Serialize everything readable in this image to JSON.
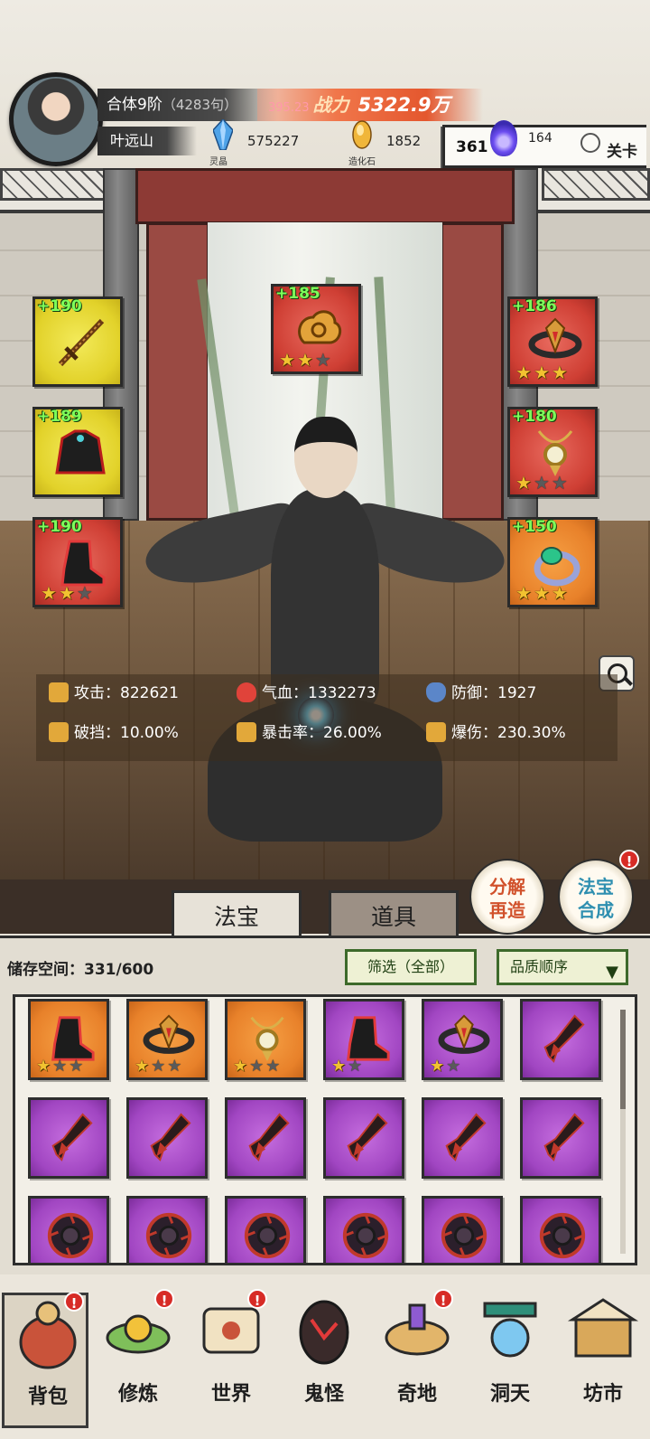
{
  "player": {
    "realm": "合体9阶",
    "realm_sub": "（4283句）",
    "name": "叶远山",
    "power_ghost": "395.23",
    "power_label": "战力",
    "power_value": "5322.9万"
  },
  "resources": [
    {
      "name": "灵晶",
      "value": "575227",
      "icon": "blue-crystal-icon",
      "color": "#4fa3e8"
    },
    {
      "name": "造化石",
      "value": "1852",
      "icon": "golden-stone-icon",
      "color": "#f0b63a"
    }
  ],
  "stage": {
    "left": "361",
    "count": "164",
    "right": "关卡",
    "icon": "purple-flame-icon"
  },
  "equipped": {
    "left": [
      {
        "bonus": "+190",
        "quality": "yellow",
        "icon": "sword-icon",
        "stars": null
      },
      {
        "bonus": "+189",
        "quality": "yellow",
        "icon": "robe-armor-icon",
        "stars": null
      },
      {
        "bonus": "+190",
        "quality": "red",
        "icon": "boots-icon",
        "stars": [
          1,
          1,
          0
        ]
      }
    ],
    "top": {
      "bonus": "+185",
      "quality": "red",
      "icon": "golden-cloud-charm-icon",
      "stars": [
        1,
        1,
        0
      ]
    },
    "right": [
      {
        "bonus": "+186",
        "quality": "red",
        "icon": "crown-belt-icon",
        "stars": [
          1,
          1,
          1
        ]
      },
      {
        "bonus": "+180",
        "quality": "red",
        "icon": "pendant-icon",
        "stars": [
          1,
          0,
          0
        ]
      },
      {
        "bonus": "+150",
        "quality": "orange",
        "icon": "jade-ring-icon",
        "stars": [
          1,
          1,
          1
        ]
      }
    ]
  },
  "stats": [
    {
      "label": "攻击",
      "value": "822621",
      "icon": "sword-stat-icon",
      "color": "#e2a83a"
    },
    {
      "label": "气血",
      "value": "1332273",
      "icon": "heart-icon",
      "color": "#e0433a"
    },
    {
      "label": "防御",
      "value": "1927",
      "icon": "shield-icon",
      "color": "#5b86c9"
    },
    {
      "label": "破挡",
      "value": "10.00%",
      "icon": "break-icon",
      "color": "#e2a83a"
    },
    {
      "label": "暴击率",
      "value": "26.00%",
      "icon": "crit-icon",
      "color": "#e2a83a"
    },
    {
      "label": "爆伤",
      "value": "230.30%",
      "icon": "crit-damage-icon",
      "color": "#e2a83a"
    }
  ],
  "side_buttons": {
    "decompose": "分解再造",
    "synthesize": "法宝合成",
    "synthesize_badge": "!"
  },
  "tabs": {
    "treasure": "法宝",
    "items": "道具"
  },
  "inventory": {
    "storage_label": "储存空间：",
    "storage_value": "331/600",
    "filter": "筛选（全部）",
    "sort": "品质顺序",
    "items": [
      {
        "quality": "orange",
        "icon": "boots-icon",
        "stars": [
          1,
          0,
          0
        ]
      },
      {
        "quality": "orange",
        "icon": "crown-belt-icon",
        "stars": [
          1,
          0,
          0
        ]
      },
      {
        "quality": "orange",
        "icon": "pendant-icon",
        "stars": [
          1,
          0,
          0
        ]
      },
      {
        "quality": "purple",
        "icon": "boots-icon",
        "stars": [
          1,
          0
        ]
      },
      {
        "quality": "purple",
        "icon": "crown-belt-icon",
        "stars": [
          1,
          0
        ]
      },
      {
        "quality": "purple",
        "icon": "dagger-icon",
        "stars": null
      },
      {
        "quality": "purple",
        "icon": "dagger-icon",
        "stars": null
      },
      {
        "quality": "purple",
        "icon": "dagger-icon",
        "stars": null
      },
      {
        "quality": "purple",
        "icon": "dagger-icon",
        "stars": null
      },
      {
        "quality": "purple",
        "icon": "dagger-icon",
        "stars": null
      },
      {
        "quality": "purple",
        "icon": "dagger-icon",
        "stars": null
      },
      {
        "quality": "purple",
        "icon": "dagger-icon",
        "stars": null
      },
      {
        "quality": "purple",
        "icon": "dark-wheel-icon",
        "stars": null
      },
      {
        "quality": "purple",
        "icon": "dark-wheel-icon",
        "stars": null
      },
      {
        "quality": "purple",
        "icon": "dark-wheel-icon",
        "stars": null
      },
      {
        "quality": "purple",
        "icon": "dark-wheel-icon",
        "stars": null
      },
      {
        "quality": "purple",
        "icon": "dark-wheel-icon",
        "stars": null
      },
      {
        "quality": "purple",
        "icon": "dark-wheel-icon",
        "stars": null
      }
    ]
  },
  "nav": [
    {
      "label": "背包",
      "icon": "bag-icon",
      "active": true,
      "badge": true
    },
    {
      "label": "修炼",
      "icon": "lotus-icon",
      "active": false,
      "badge": true
    },
    {
      "label": "世界",
      "icon": "scroll-map-icon",
      "active": false,
      "badge": true
    },
    {
      "label": "鬼怪",
      "icon": "demon-egg-icon",
      "active": false,
      "badge": false
    },
    {
      "label": "奇地",
      "icon": "floating-island-icon",
      "active": false,
      "badge": true
    },
    {
      "label": "洞天",
      "icon": "portal-icon",
      "active": false,
      "badge": false
    },
    {
      "label": "坊市",
      "icon": "market-stall-icon",
      "active": false,
      "badge": false
    }
  ],
  "colors": {
    "yellow": "#e2d22a",
    "red": "#cf3f34",
    "orange": "#e8812a",
    "purple": "#a146c2",
    "bonus_text": "#7eff5a",
    "power_bar": "#e4572e"
  }
}
